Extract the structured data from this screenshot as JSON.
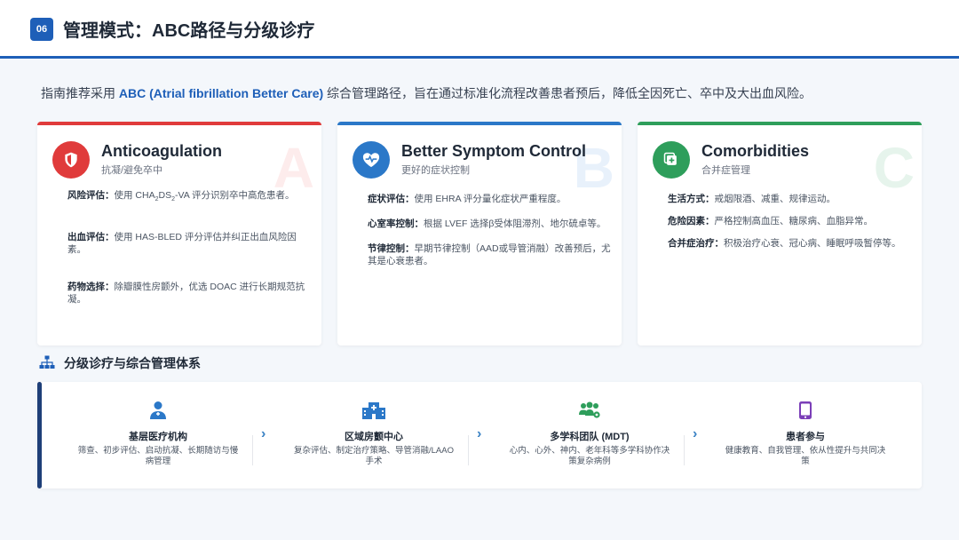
{
  "header": {
    "badge": "06",
    "title": "管理模式：ABC路径与分级诊疗"
  },
  "intro": {
    "prefix": "指南推荐采用 ",
    "highlight": "ABC (Atrial fibrillation Better Care)",
    "suffix": " 综合管理路径，旨在通过标准化流程改善患者预后，降低全因死亡、卒中及大出血风险。"
  },
  "colors": {
    "accent": "#1e5fb8",
    "red": "#e03b3b",
    "blue": "#2b78c8",
    "green": "#2e9e5b",
    "dark_bar": "#1e3f78"
  },
  "cards": [
    {
      "letter": "A",
      "title": "Anticoagulation",
      "subtitle": "抗凝/避免卒中",
      "icon": "shield-icon",
      "items": [
        {
          "label": "风险评估：",
          "pre": "使用 CHA",
          "sub1": "2",
          "mid": "DS",
          "sub2": "2",
          "post": "-VA 评分识别卒中高危患者。"
        },
        {
          "label": "出血评估：",
          "text": "使用 HAS-BLED 评分评估并纠正出血风险因素。"
        },
        {
          "label": "药物选择：",
          "text": "除瓣膜性房颤外，优选 DOAC 进行长期规范抗凝。"
        }
      ]
    },
    {
      "letter": "B",
      "title": "Better Symptom Control",
      "subtitle": "更好的症状控制",
      "icon": "heart-pulse-icon",
      "items": [
        {
          "label": "症状评估：",
          "text": "使用 EHRA 评分量化症状严重程度。"
        },
        {
          "label": "心室率控制：",
          "text": "根据 LVEF 选择β受体阻滞剂、地尔硫卓等。"
        },
        {
          "label": "节律控制：",
          "text": "早期节律控制（AAD或导管消融）改善预后，尤其是心衰患者。"
        }
      ]
    },
    {
      "letter": "C",
      "title": "Comorbidities",
      "subtitle": "合并症管理",
      "icon": "medical-plus-icon",
      "items": [
        {
          "label": "生活方式：",
          "text": "戒烟限酒、减重、规律运动。"
        },
        {
          "label": "危险因素：",
          "text": "严格控制高血压、糖尿病、血脂异常。"
        },
        {
          "label": "合并症治疗：",
          "text": "积极治疗心衰、冠心病、睡眠呼吸暂停等。"
        }
      ]
    }
  ],
  "section": {
    "icon": "sitemap-icon",
    "title": "分级诊疗与综合管理体系"
  },
  "steps": [
    {
      "icon": "doctor-icon",
      "title": "基层医疗机构",
      "desc": "筛查、初步评估、启动抗凝、长期随访与慢病管理"
    },
    {
      "icon": "hospital-icon",
      "title": "区域房颤中心",
      "desc": "复杂评估、制定治疗策略、导管消融/LAAO手术"
    },
    {
      "icon": "team-icon",
      "title": "多学科团队 (MDT)",
      "desc": "心内、心外、神内、老年科等多学科协作决策复杂病例"
    },
    {
      "icon": "mobile-icon",
      "title": "患者参与",
      "desc": "健康教育、自我管理、依从性提升与共同决策"
    }
  ],
  "chevron": "›"
}
